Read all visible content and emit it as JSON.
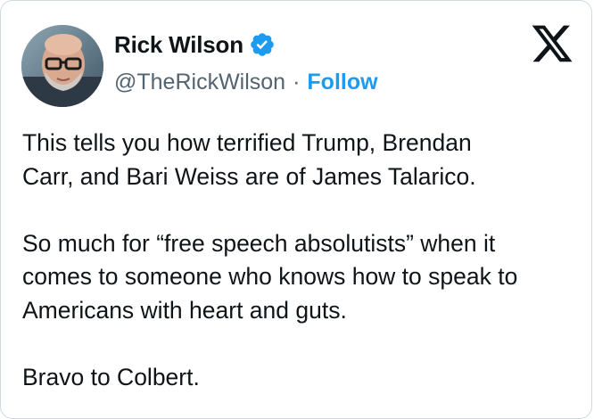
{
  "author": {
    "name": "Rick Wilson",
    "handle": "@TheRickWilson",
    "separator": "·",
    "follow_label": "Follow",
    "verified": true,
    "verified_icon": "verified-badge-icon",
    "avatar": "profile-photo"
  },
  "platform_icon": "x-logo-icon",
  "tweet": {
    "lines": [
      "This tells you how terrified Trump, Brendan",
      "Carr, and Bari Weiss are of James Talarico.",
      "",
      "So much for “free speech absolutists” when it",
      "comes to someone who knows how to speak to",
      "Americans with heart and guts.",
      "",
      "Bravo to Colbert."
    ]
  },
  "colors": {
    "text": "#0f1419",
    "secondary": "#536471",
    "accent": "#1d9bf0",
    "border": "#cfd9de"
  }
}
